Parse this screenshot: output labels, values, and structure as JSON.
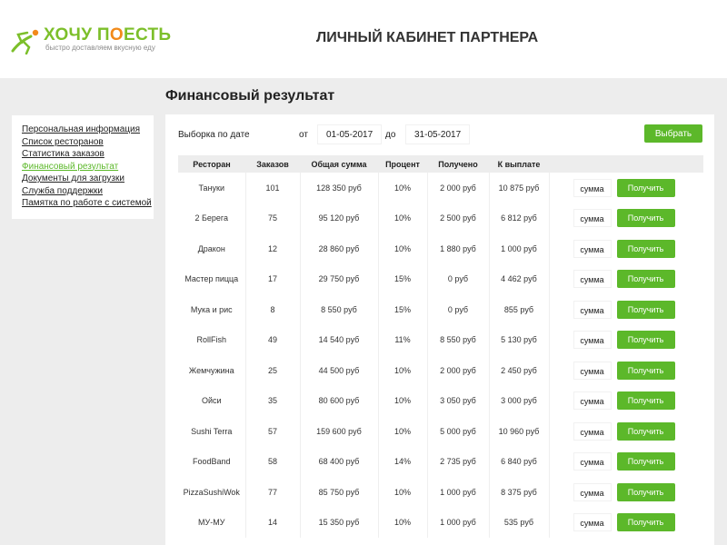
{
  "header": {
    "logo_text_1": "ХОЧУ П",
    "logo_text_2": "О",
    "logo_text_3": "ЕСТЬ",
    "logo_tagline": "быстро доставляем вкусную еду",
    "title": "ЛИЧНЫЙ КАБИНЕТ ПАРТНЕРА"
  },
  "page_title": "Финансовый результат",
  "sidebar": {
    "items": [
      {
        "label": "Персональная информация"
      },
      {
        "label": "Список ресторанов"
      },
      {
        "label": "Статистика заказов"
      },
      {
        "label": "Финансовый результат"
      },
      {
        "label": "Документы для загрузки"
      },
      {
        "label": "Служба поддержки"
      },
      {
        "label": "Памятка по работе с системой"
      }
    ]
  },
  "filter": {
    "label": "Выборка по дате",
    "from_label": "от",
    "from_value": "01-05-2017",
    "to_label": "до",
    "to_value": "31-05-2017",
    "button": "Выбрать"
  },
  "table": {
    "headers": [
      "Ресторан",
      "Заказов",
      "Общая сумма",
      "Процент",
      "Получено",
      "К выплате"
    ],
    "sum_placeholder": "сумма",
    "get_button": "Получить",
    "rows": [
      {
        "name": "Тануки",
        "orders": "101",
        "total": "128 350 руб",
        "percent": "10%",
        "received": "2 000 руб",
        "payout": "10 875 руб"
      },
      {
        "name": "2 Берега",
        "orders": "75",
        "total": "95 120 руб",
        "percent": "10%",
        "received": "2 500 руб",
        "payout": "6 812 руб"
      },
      {
        "name": "Дракон",
        "orders": "12",
        "total": "28 860 руб",
        "percent": "10%",
        "received": "1 880 руб",
        "payout": "1 000 руб"
      },
      {
        "name": "Мастер пицца",
        "orders": "17",
        "total": "29 750 руб",
        "percent": "15%",
        "received": "0 руб",
        "payout": "4 462 руб"
      },
      {
        "name": "Мука и рис",
        "orders": "8",
        "total": "8 550 руб",
        "percent": "15%",
        "received": "0 руб",
        "payout": "855 руб"
      },
      {
        "name": "RollFish",
        "orders": "49",
        "total": "14 540 руб",
        "percent": "11%",
        "received": "8 550 руб",
        "payout": "5 130 руб"
      },
      {
        "name": "Жемчужина",
        "orders": "25",
        "total": "44 500 руб",
        "percent": "10%",
        "received": "2 000 руб",
        "payout": "2 450 руб"
      },
      {
        "name": "Ойси",
        "orders": "35",
        "total": "80 600 руб",
        "percent": "10%",
        "received": "3 050 руб",
        "payout": "3 000 руб"
      },
      {
        "name": "Sushi Terra",
        "orders": "57",
        "total": "159 600 руб",
        "percent": "10%",
        "received": "5 000 руб",
        "payout": "10 960 руб"
      },
      {
        "name": "FoodBand",
        "orders": "58",
        "total": "68 400 руб",
        "percent": "14%",
        "received": "2 735 руб",
        "payout": "6 840 руб"
      },
      {
        "name": "PizzaSushiWok",
        "orders": "77",
        "total": "85 750 руб",
        "percent": "10%",
        "received": "1 000 руб",
        "payout": "8 375 руб"
      },
      {
        "name": "МУ-МУ",
        "orders": "14",
        "total": "15 350 руб",
        "percent": "10%",
        "received": "1 000 руб",
        "payout": "535 руб"
      }
    ]
  },
  "colors": {
    "accent": "#5cb82a",
    "logo_green": "#7cbf2a",
    "logo_orange": "#f28a1a"
  },
  "icons": {
    "logo": "running-person-icon"
  }
}
